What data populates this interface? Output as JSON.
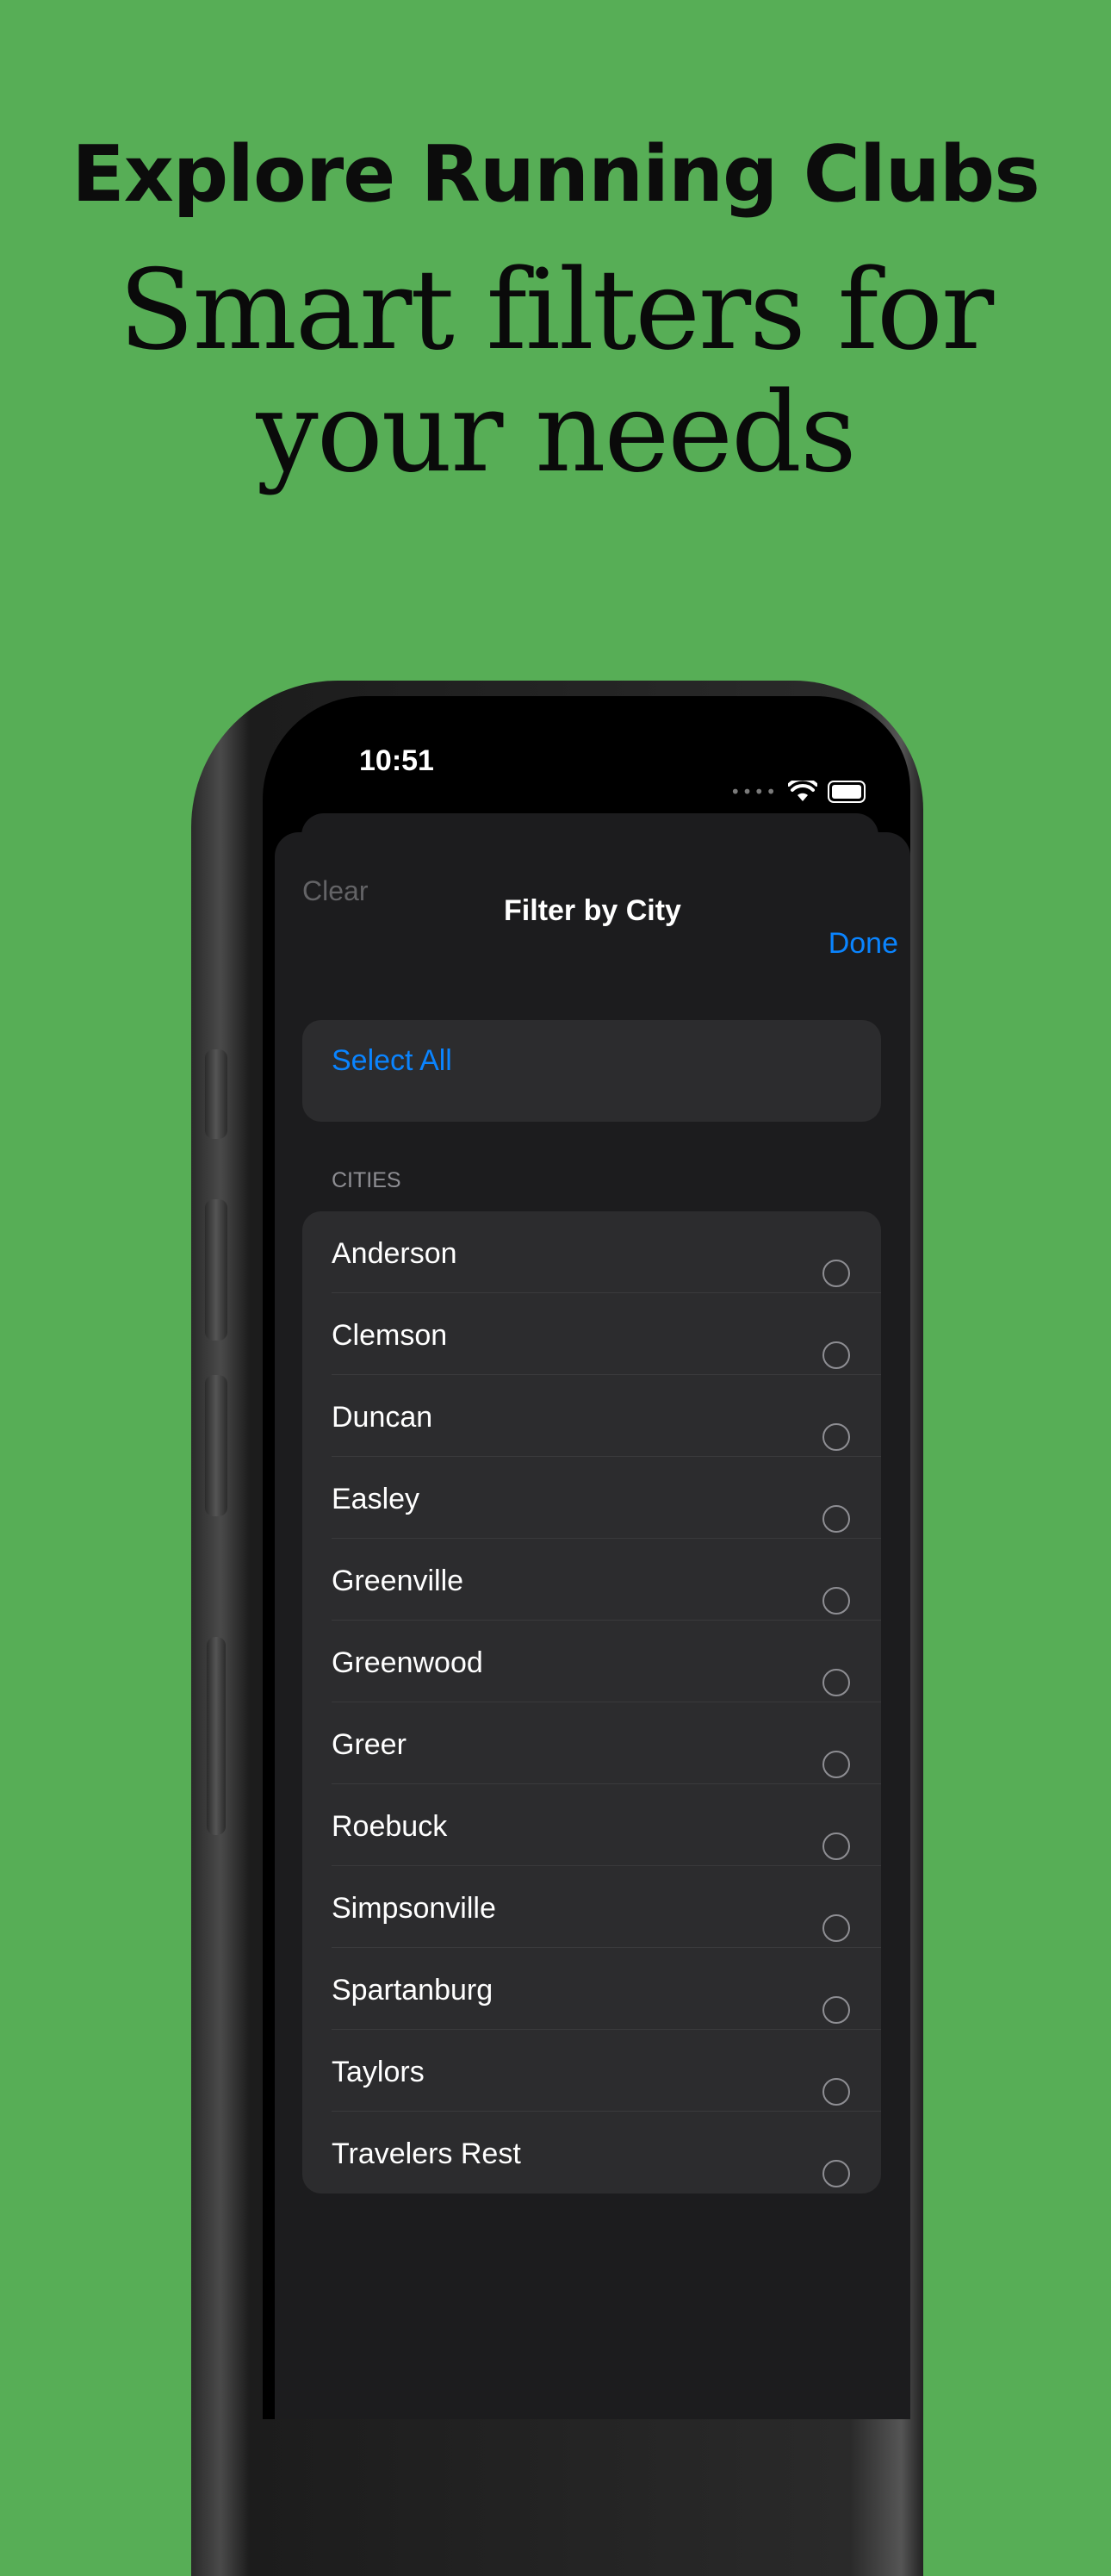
{
  "marketing": {
    "headline": "Explore Running Clubs",
    "subhead_line1": "Smart filters for",
    "subhead_line2": "your needs"
  },
  "colors": {
    "background": "#57ae56",
    "accent": "#0a84ff",
    "sheet": "#1c1c1e",
    "card": "#2c2c2e"
  },
  "status_bar": {
    "time": "10:51",
    "icons": [
      "signal-dots-icon",
      "wifi-icon",
      "battery-icon"
    ]
  },
  "nav": {
    "clear_label": "Clear",
    "title": "Filter by City",
    "done_label": "Done"
  },
  "select_all_label": "Select All",
  "cities_header": "CITIES",
  "cities": [
    {
      "label": "Anderson",
      "selected": false
    },
    {
      "label": "Clemson",
      "selected": false
    },
    {
      "label": "Duncan",
      "selected": false
    },
    {
      "label": "Easley",
      "selected": false
    },
    {
      "label": "Greenville",
      "selected": false
    },
    {
      "label": "Greenwood",
      "selected": false
    },
    {
      "label": "Greer",
      "selected": false
    },
    {
      "label": "Roebuck",
      "selected": false
    },
    {
      "label": "Simpsonville",
      "selected": false
    },
    {
      "label": "Spartanburg",
      "selected": false
    },
    {
      "label": "Taylors",
      "selected": false
    },
    {
      "label": "Travelers Rest",
      "selected": false
    }
  ]
}
